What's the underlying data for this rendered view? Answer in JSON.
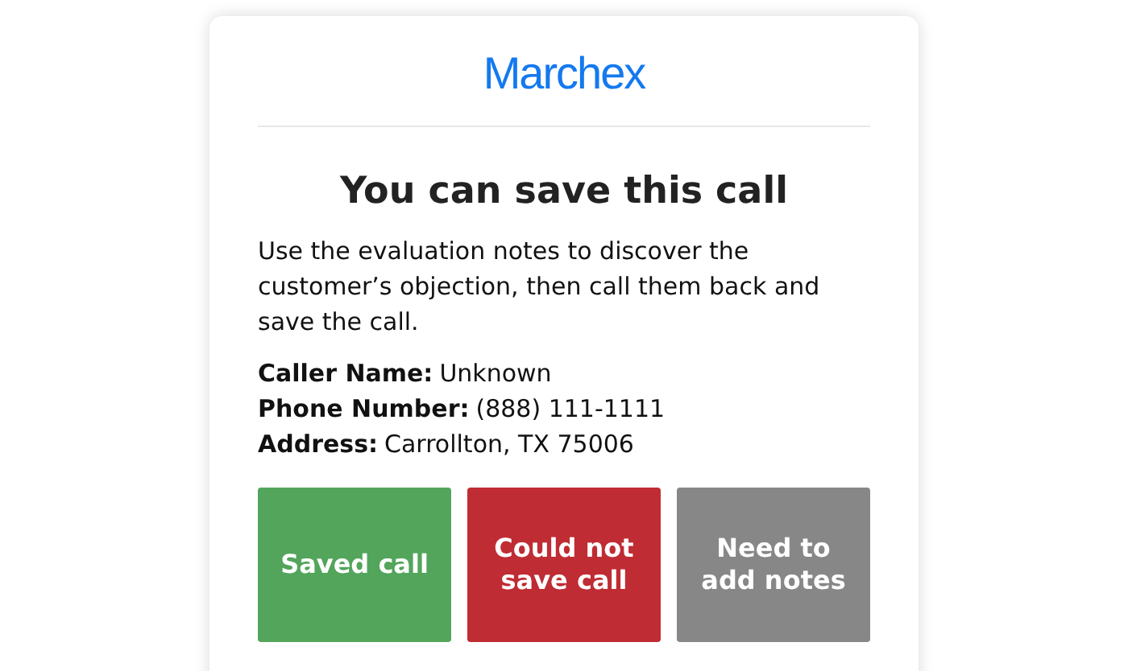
{
  "logo": "Marchex",
  "title": "You can save this call",
  "message": "Use the evaluation notes to discover the customer’s objection, then call them back and save the call.",
  "details": [
    {
      "label": "Caller Name:",
      "value": "Unknown"
    },
    {
      "label": "Phone Number:",
      "value": "(888) 111-1111"
    },
    {
      "label": "Address:",
      "value": "Carrollton, TX 75006"
    }
  ],
  "buttons": [
    {
      "label": "Saved call",
      "color": "#52a55b"
    },
    {
      "label": "Could not save call",
      "color": "#bf2c33"
    },
    {
      "label": "Need to add notes",
      "color": "#878787"
    }
  ]
}
